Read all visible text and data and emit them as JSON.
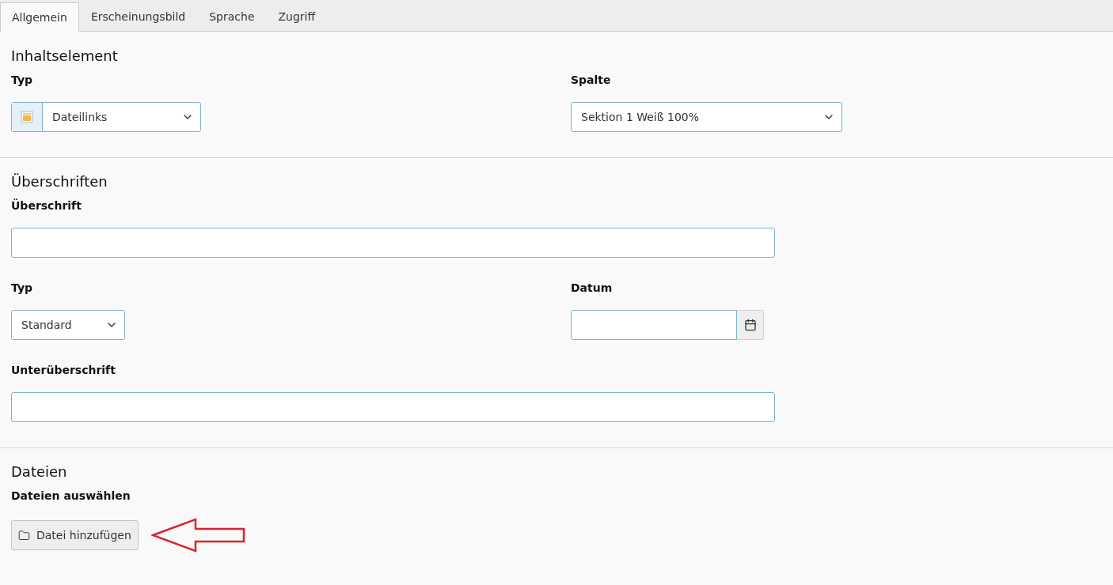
{
  "tabs": [
    {
      "label": "Allgemein",
      "selected": true
    },
    {
      "label": "Erscheinungsbild",
      "selected": false
    },
    {
      "label": "Sprache",
      "selected": false
    },
    {
      "label": "Zugriff",
      "selected": false
    }
  ],
  "sections": [
    {
      "title": "Inhaltselement",
      "rows": [
        [
          {
            "kind": "select_icon",
            "label": "Typ",
            "value": "Dateilinks"
          },
          {
            "kind": "select",
            "label": "Spalte",
            "value": "Sektion 1 Weiß 100%"
          }
        ]
      ]
    },
    {
      "title": "Überschriften",
      "rows": [
        [
          {
            "kind": "text",
            "label": "Überschrift"
          }
        ],
        [
          {
            "kind": "select",
            "label": "Typ",
            "value": "Standard"
          },
          {
            "kind": "date",
            "label": "Datum"
          }
        ],
        [
          {
            "kind": "text",
            "label": "Unterüberschrift"
          }
        ]
      ]
    },
    {
      "title": "Dateien",
      "rows": [
        [
          {
            "kind": "button",
            "label": "Dateien auswählen",
            "value": "Datei hinzufügen"
          }
        ]
      ]
    }
  ]
}
